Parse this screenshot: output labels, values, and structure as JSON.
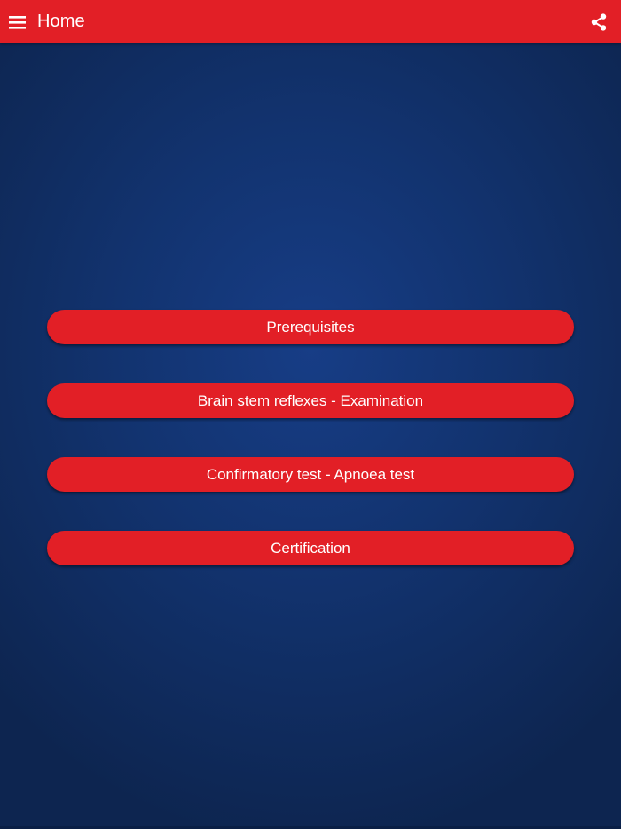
{
  "app": {
    "title": "Home",
    "colors": {
      "primary": "#e21f26",
      "background": "#12336f",
      "text_on_primary": "#ffffff"
    }
  },
  "toolbar": {
    "menu_icon": "hamburger-menu-icon",
    "share_icon": "share-icon"
  },
  "menu": {
    "items": [
      {
        "label": "Prerequisites"
      },
      {
        "label": "Brain stem reflexes - Examination"
      },
      {
        "label": "Confirmatory test - Apnoea test"
      },
      {
        "label": "Certification"
      }
    ]
  }
}
